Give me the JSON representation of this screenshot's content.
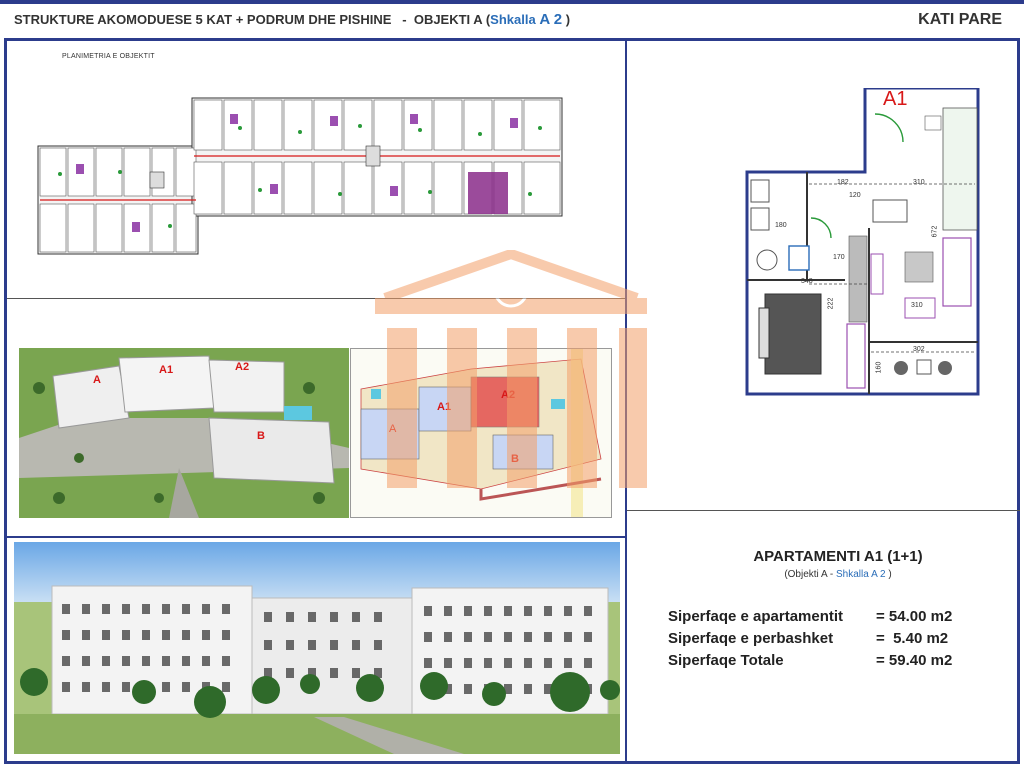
{
  "header": {
    "title_main": "STRUKTURE AKOMODUESE 5 KAT + PODRUM DHE PISHINE",
    "title_sep": "-",
    "title_obj": "OBJEKTI A (",
    "title_shk": "Shkalla",
    "title_shk_num": "A 2",
    "title_close": ")",
    "floor": "KATI PARE"
  },
  "site_plan": {
    "caption": "PLANIMETRIA E OBJEKTIT"
  },
  "unit_plan": {
    "label": "A1",
    "dims": [
      "182",
      "310",
      "120",
      "672",
      "170",
      "348",
      "310",
      "302",
      "222",
      "160",
      "180"
    ]
  },
  "aerial": {
    "labels": [
      "A",
      "A1",
      "A2",
      "B"
    ]
  },
  "site_diagram": {
    "labels": [
      "A",
      "A1",
      "A2",
      "B"
    ]
  },
  "apartment": {
    "title": "APARTAMENTI A1 (1+1)",
    "sub_obj": "(Objekti A -",
    "sub_shk": "Shkalla",
    "sub_shk_num": "A 2",
    "sub_close": ")",
    "rows": [
      {
        "label": "Siperfaqe e apartamentit",
        "value": "= 54.00 m2"
      },
      {
        "label": "Siperfaqe e perbashket",
        "value": "=  5.40 m2"
      },
      {
        "label": "Siperfaqe Totale",
        "value": "= 59.40 m2"
      }
    ]
  },
  "colors": {
    "frame": "#2c3c8c",
    "accent": "#2a6db8",
    "highlight_unit": "#8a2c8a",
    "label_red": "#d81818",
    "watermark": "#f4a06a"
  }
}
